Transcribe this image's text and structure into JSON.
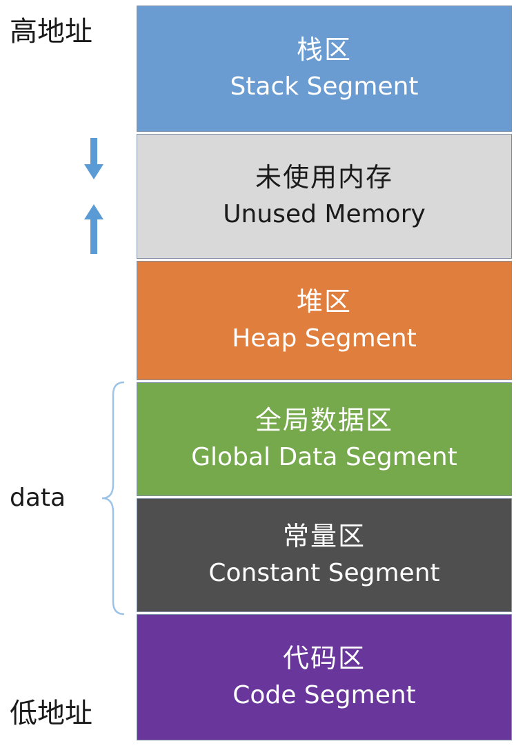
{
  "labels": {
    "high": "高地址",
    "low": "低地址",
    "data": "data"
  },
  "segments": [
    {
      "cn": "栈区",
      "en": "Stack Segment",
      "bg": "#6a9bd1",
      "fg": "#ffffff"
    },
    {
      "cn": "未使用内存",
      "en": "Unused Memory",
      "bg": "#d9d9d9",
      "fg": "#1a1a1a"
    },
    {
      "cn": "堆区",
      "en": "Heap Segment",
      "bg": "#e07e3d",
      "fg": "#ffffff"
    },
    {
      "cn": "全局数据区",
      "en": "Global Data Segment",
      "bg": "#76a94c",
      "fg": "#ffffff"
    },
    {
      "cn": "常量区",
      "en": "Constant Segment",
      "bg": "#4f4f4f",
      "fg": "#ffffff"
    },
    {
      "cn": "代码区",
      "en": "Code Segment",
      "bg": "#69369b",
      "fg": "#ffffff"
    }
  ],
  "arrows": [
    {
      "icon": "arrow-down-icon",
      "color": "#5b9bd5"
    },
    {
      "icon": "arrow-up-icon",
      "color": "#5b9bd5"
    }
  ],
  "brace_color": "#9dc3e6"
}
